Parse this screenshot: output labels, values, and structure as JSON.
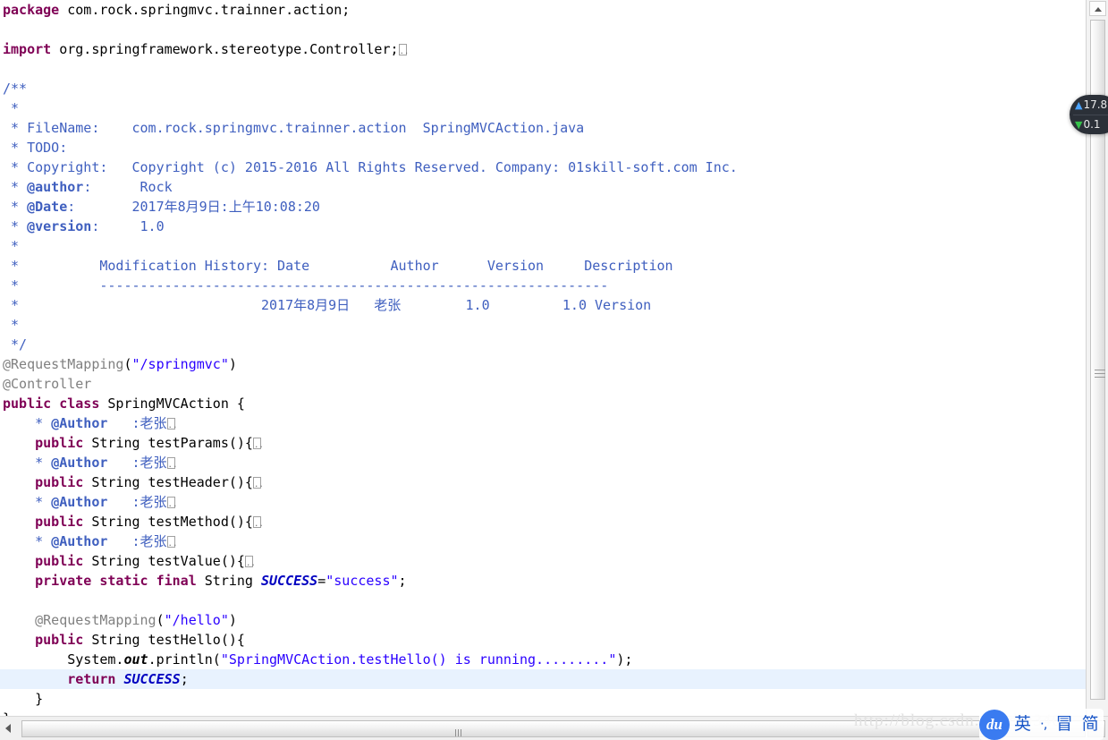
{
  "editor": {
    "file_title": "SpringMVCAction.java",
    "current_line_index": 34,
    "lines": [
      [
        {
          "t": "package",
          "c": "kw"
        },
        {
          "t": " com.rock.springmvc.trainner.action;",
          "c": "plain"
        }
      ],
      [],
      [
        {
          "t": "import",
          "c": "kw"
        },
        {
          "t": " org.springframework.stereotype.Controller;",
          "c": "plain"
        },
        {
          "t": "",
          "c": "fold"
        }
      ],
      [],
      [
        {
          "t": "/**",
          "c": "cmt"
        }
      ],
      [
        {
          "t": " *",
          "c": "cmt"
        }
      ],
      [
        {
          "t": " * FileName:    com.rock.springmvc.trainner.action  SpringMVCAction.java",
          "c": "cmt"
        }
      ],
      [
        {
          "t": " * TODO:",
          "c": "cmt"
        }
      ],
      [
        {
          "t": " * Copyright:   Copyright (c) 2015-2016 All Rights Reserved. Company: 01skill-soft.com Inc.",
          "c": "cmt"
        }
      ],
      [
        {
          "t": " * ",
          "c": "cmt"
        },
        {
          "t": "@author",
          "c": "cmtb"
        },
        {
          "t": ":      Rock",
          "c": "cmt"
        }
      ],
      [
        {
          "t": " * ",
          "c": "cmt"
        },
        {
          "t": "@Date",
          "c": "cmtb"
        },
        {
          "t": ":       2017年8月9日:上午10:08:20",
          "c": "cmt"
        }
      ],
      [
        {
          "t": " * ",
          "c": "cmt"
        },
        {
          "t": "@version",
          "c": "cmtb"
        },
        {
          "t": ":     1.0",
          "c": "cmt"
        }
      ],
      [
        {
          "t": " *",
          "c": "cmt"
        }
      ],
      [
        {
          "t": " *          Modification History: Date          Author      Version     Description",
          "c": "cmt"
        }
      ],
      [
        {
          "t": " *          ---------------------------------------------------------------",
          "c": "cmt"
        }
      ],
      [
        {
          "t": " *                              2017年8月9日   老张        1.0         1.0 Version",
          "c": "cmt"
        }
      ],
      [
        {
          "t": " *",
          "c": "cmt"
        }
      ],
      [
        {
          "t": " */",
          "c": "cmt"
        }
      ],
      [
        {
          "t": "@RequestMapping",
          "c": "ann"
        },
        {
          "t": "(",
          "c": "plain"
        },
        {
          "t": "\"/springmvc\"",
          "c": "str"
        },
        {
          "t": ")",
          "c": "plain"
        }
      ],
      [
        {
          "t": "@Controller",
          "c": "ann"
        }
      ],
      [
        {
          "t": "public",
          "c": "kw"
        },
        {
          "t": " ",
          "c": "plain"
        },
        {
          "t": "class",
          "c": "kw"
        },
        {
          "t": " SpringMVCAction {",
          "c": "plain"
        }
      ],
      [
        {
          "t": "    * ",
          "c": "cmt"
        },
        {
          "t": "@Author",
          "c": "cmtb"
        },
        {
          "t": "   :老张",
          "c": "cmt"
        },
        {
          "t": "",
          "c": "fold"
        }
      ],
      [
        {
          "t": "    ",
          "c": "plain"
        },
        {
          "t": "public",
          "c": "kw"
        },
        {
          "t": " String testParams(){",
          "c": "plain"
        },
        {
          "t": "",
          "c": "fold"
        }
      ],
      [
        {
          "t": "    * ",
          "c": "cmt"
        },
        {
          "t": "@Author",
          "c": "cmtb"
        },
        {
          "t": "   :老张",
          "c": "cmt"
        },
        {
          "t": "",
          "c": "fold"
        }
      ],
      [
        {
          "t": "    ",
          "c": "plain"
        },
        {
          "t": "public",
          "c": "kw"
        },
        {
          "t": " String testHeader(){",
          "c": "plain"
        },
        {
          "t": "",
          "c": "fold"
        }
      ],
      [
        {
          "t": "    * ",
          "c": "cmt"
        },
        {
          "t": "@Author",
          "c": "cmtb"
        },
        {
          "t": "   :老张",
          "c": "cmt"
        },
        {
          "t": "",
          "c": "fold"
        }
      ],
      [
        {
          "t": "    ",
          "c": "plain"
        },
        {
          "t": "public",
          "c": "kw"
        },
        {
          "t": " String testMethod(){",
          "c": "plain"
        },
        {
          "t": "",
          "c": "fold"
        }
      ],
      [
        {
          "t": "    * ",
          "c": "cmt"
        },
        {
          "t": "@Author",
          "c": "cmtb"
        },
        {
          "t": "   :老张",
          "c": "cmt"
        },
        {
          "t": "",
          "c": "fold"
        }
      ],
      [
        {
          "t": "    ",
          "c": "plain"
        },
        {
          "t": "public",
          "c": "kw"
        },
        {
          "t": " String testValue(){",
          "c": "plain"
        },
        {
          "t": "",
          "c": "fold"
        }
      ],
      [
        {
          "t": "    ",
          "c": "plain"
        },
        {
          "t": "private",
          "c": "kw"
        },
        {
          "t": " ",
          "c": "plain"
        },
        {
          "t": "static",
          "c": "kw"
        },
        {
          "t": " ",
          "c": "plain"
        },
        {
          "t": "final",
          "c": "kw"
        },
        {
          "t": " String ",
          "c": "plain"
        },
        {
          "t": "SUCCESS",
          "c": "fld"
        },
        {
          "t": "=",
          "c": "plain"
        },
        {
          "t": "\"success\"",
          "c": "str"
        },
        {
          "t": ";",
          "c": "plain"
        }
      ],
      [],
      [
        {
          "t": "    ",
          "c": "plain"
        },
        {
          "t": "@RequestMapping",
          "c": "ann"
        },
        {
          "t": "(",
          "c": "plain"
        },
        {
          "t": "\"/hello\"",
          "c": "str"
        },
        {
          "t": ")",
          "c": "plain"
        }
      ],
      [
        {
          "t": "    ",
          "c": "plain"
        },
        {
          "t": "public",
          "c": "kw"
        },
        {
          "t": " String testHello(){",
          "c": "plain"
        }
      ],
      [
        {
          "t": "        System.",
          "c": "plain"
        },
        {
          "t": "out",
          "c": "stc"
        },
        {
          "t": ".println(",
          "c": "plain"
        },
        {
          "t": "\"SpringMVCAction.testHello() is running.........\"",
          "c": "str"
        },
        {
          "t": ");",
          "c": "plain"
        }
      ],
      [
        {
          "t": "        ",
          "c": "plain"
        },
        {
          "t": "return",
          "c": "kw"
        },
        {
          "t": " ",
          "c": "plain"
        },
        {
          "t": "SUCCESS",
          "c": "fld"
        },
        {
          "t": ";",
          "c": "plain"
        }
      ],
      [
        {
          "t": "    }",
          "c": "plain"
        }
      ],
      [
        {
          "t": "}",
          "c": "plain"
        }
      ]
    ]
  },
  "watermark": {
    "text": "http://blog.csdn.net/dl0346"
  },
  "network_widget": {
    "upload": "17.8",
    "download": "0.1",
    "up_arrow": "arrow-up-icon",
    "down_arrow": "arrow-down-icon"
  },
  "ime_bar": {
    "logo": "du",
    "items": [
      {
        "label": "英",
        "name": "ime-language-toggle"
      },
      {
        "label": "·,",
        "name": "ime-punctuation-toggle"
      },
      {
        "label": "冒",
        "name": "ime-toolbox-icon"
      },
      {
        "label": "简",
        "name": "ime-simplified-toggle"
      }
    ]
  },
  "scrollbars": {
    "vertical_up_arrow": "scroll-up-arrow-icon",
    "horizontal_left_arrow": "scroll-left-arrow-icon"
  },
  "colors": {
    "keyword": "#7f0055",
    "string": "#2a00ff",
    "comment": "#3f5fbf",
    "annotation": "#808080",
    "static_field": "#0000c0",
    "current_line_bg": "#e8f2fe",
    "ime_accent": "#3a7bf0"
  }
}
